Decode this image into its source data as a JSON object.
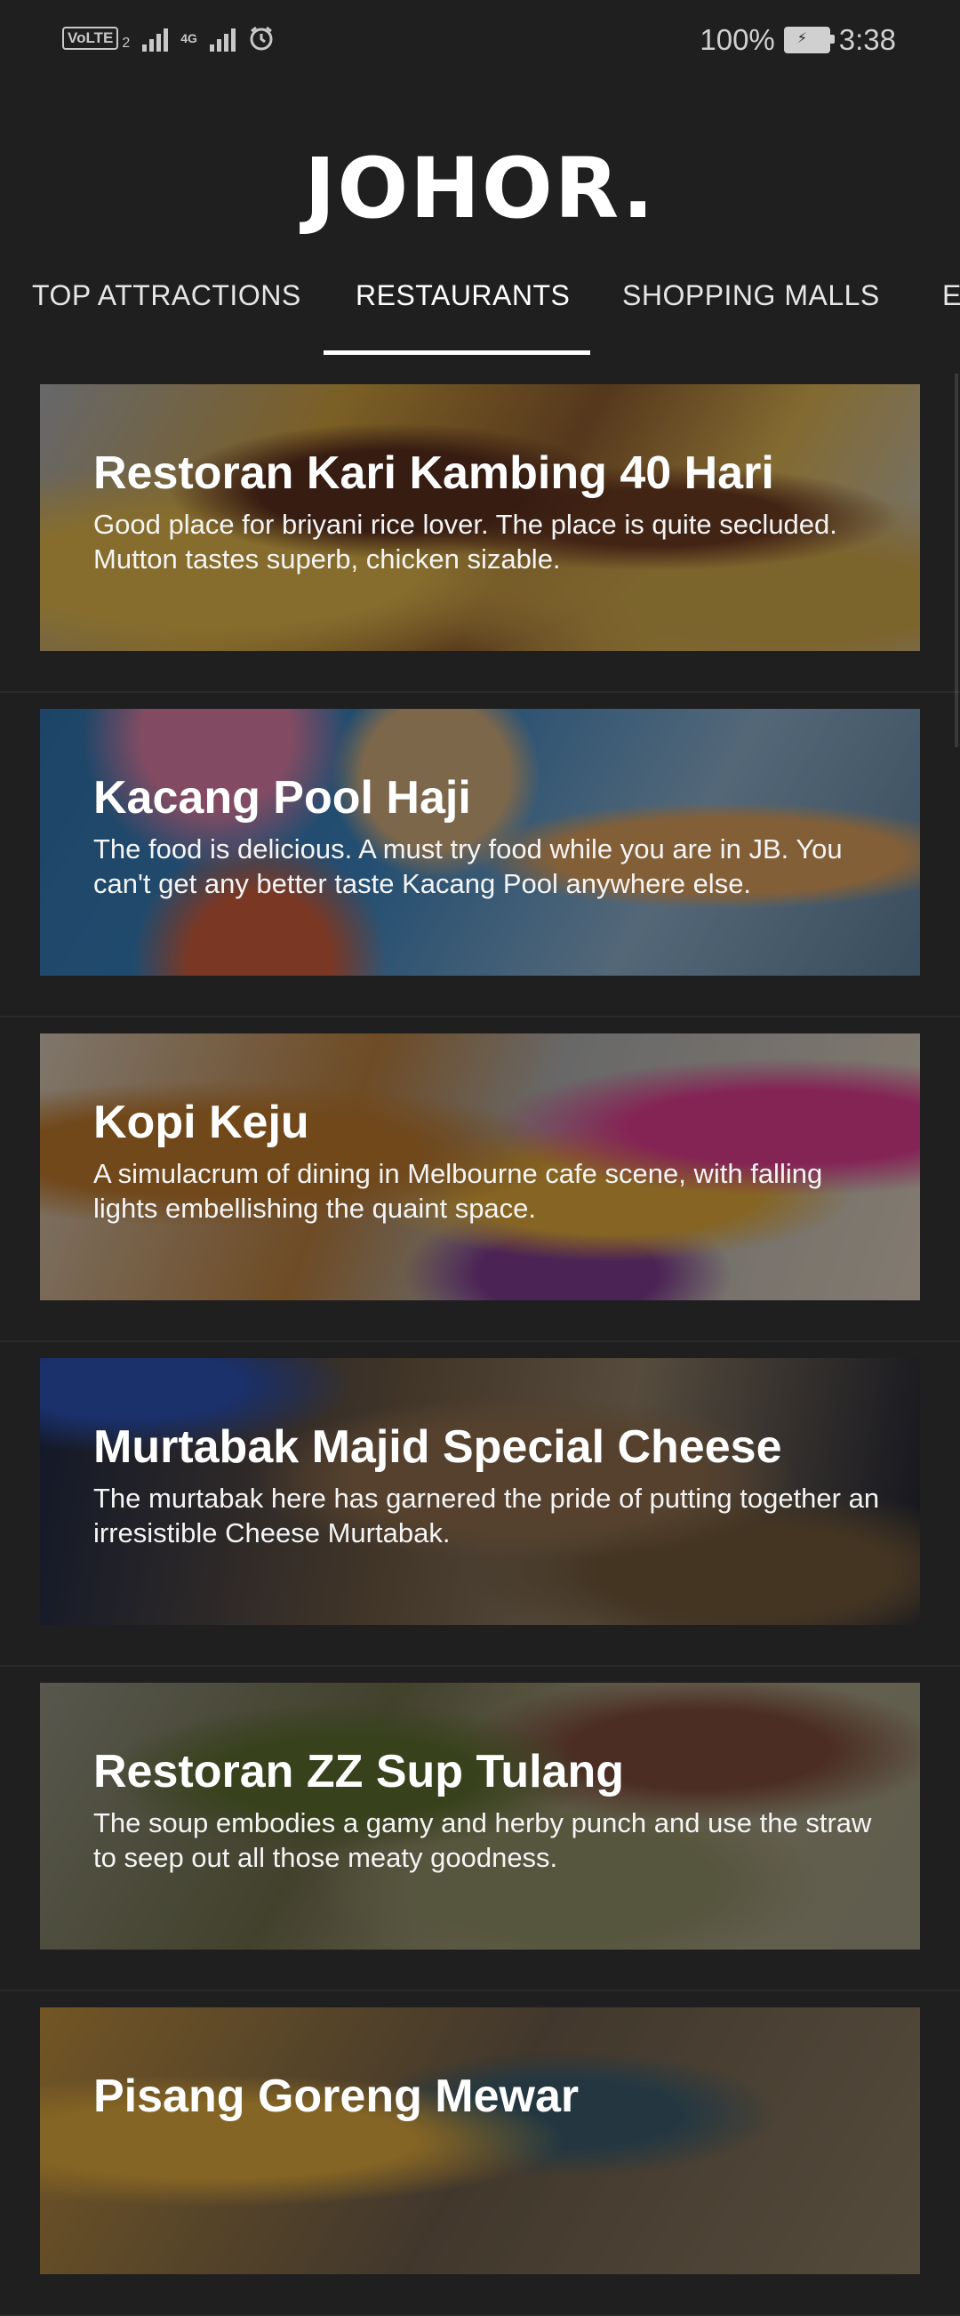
{
  "status_bar": {
    "volte": "VoLTE",
    "sim": "2",
    "network": "4G",
    "battery": "100%",
    "time": "3:38"
  },
  "header": {
    "title": "JOHOR."
  },
  "tabs": [
    {
      "label": "TOP ATTRACTIONS"
    },
    {
      "label": "RESTAURANTS",
      "active": true
    },
    {
      "label": "SHOPPING MALLS"
    },
    {
      "label": "E"
    }
  ],
  "restaurants": [
    {
      "name": "Restoran Kari Kambing 40 Hari",
      "description": "Good place for briyani rice lover. The place is quite secluded. Mutton tastes superb, chicken sizable."
    },
    {
      "name": "Kacang Pool Haji",
      "description": "The food is delicious. A must try food while you are in JB. You can't get any better taste Kacang Pool anywhere else."
    },
    {
      "name": "Kopi Keju",
      "description": "A simulacrum of dining in Melbourne cafe scene, with falling lights embellishing the quaint space."
    },
    {
      "name": "Murtabak Majid Special Cheese",
      "description": "The murtabak here has garnered the pride of putting together an irresistible Cheese Murtabak."
    },
    {
      "name": "Restoran ZZ Sup Tulang",
      "description": "The soup embodies a gamy and herby punch and use the straw to seep out all those meaty goodness."
    },
    {
      "name": "Pisang Goreng Mewar",
      "description": ""
    }
  ],
  "colors": {
    "background": "#1f1f20",
    "accent": "#ffffff"
  }
}
